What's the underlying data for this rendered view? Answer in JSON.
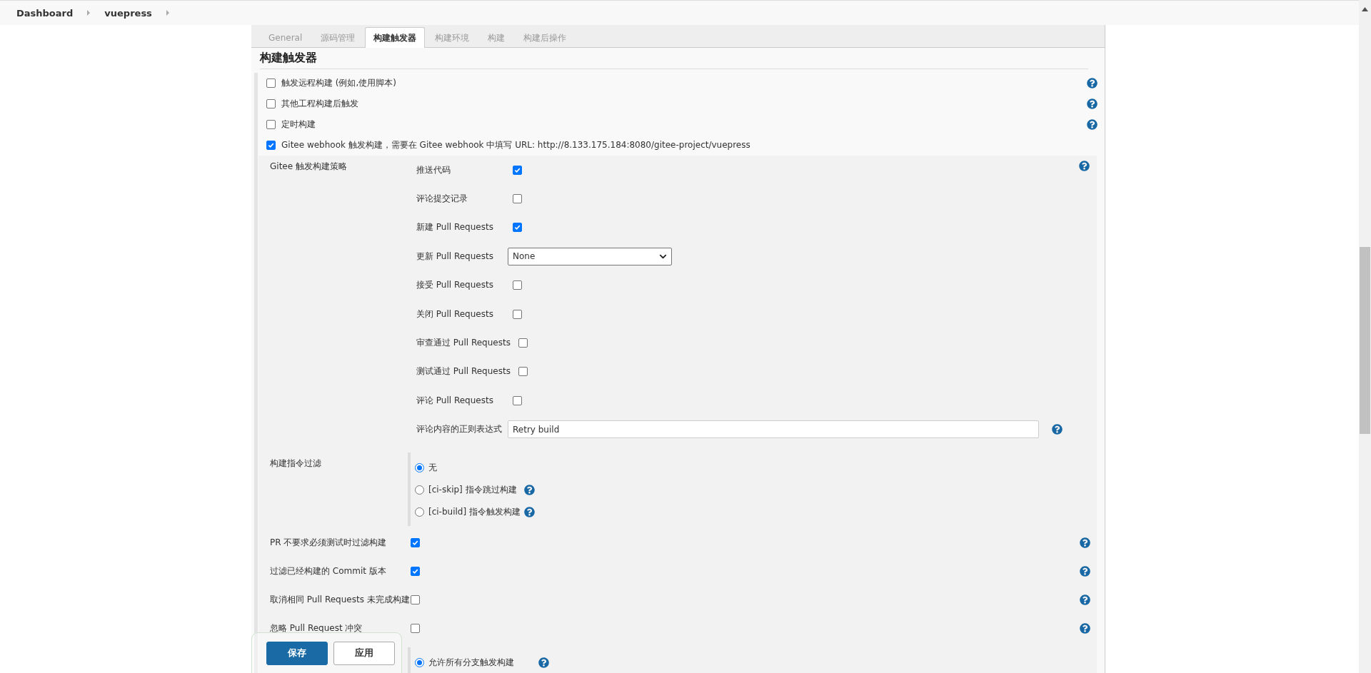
{
  "breadcrumbs": [
    "Dashboard",
    "vuepress"
  ],
  "tabs": [
    {
      "label": "General",
      "selected": false
    },
    {
      "label": "源码管理",
      "selected": false
    },
    {
      "label": "构建触发器",
      "selected": true
    },
    {
      "label": "构建环境",
      "selected": false
    },
    {
      "label": "构建",
      "selected": false
    },
    {
      "label": "构建后操作",
      "selected": false
    }
  ],
  "section_title": "构建触发器",
  "triggers": [
    {
      "label": "触发远程构建 (例如,使用脚本)",
      "checked": false,
      "help": true
    },
    {
      "label": "其他工程构建后触发",
      "checked": false,
      "help": true
    },
    {
      "label": "定时构建",
      "checked": false,
      "help": true
    },
    {
      "label": "Gitee webhook 触发构建，需要在 Gitee webhook 中填写 URL: http://8.133.175.184:8080/gitee-project/vuepress",
      "checked": true,
      "help": false
    }
  ],
  "gitee": {
    "strategy_label": "Gitee 触发构建策略",
    "strategy_items": [
      {
        "kind": "checkbox",
        "label": "推送代码",
        "checked": true
      },
      {
        "kind": "checkbox",
        "label": "评论提交记录",
        "checked": false
      },
      {
        "kind": "checkbox",
        "label": "新建 Pull Requests",
        "checked": true
      },
      {
        "kind": "select",
        "label": "更新 Pull Requests",
        "value": "None"
      },
      {
        "kind": "checkbox",
        "label": "接受 Pull Requests",
        "checked": false
      },
      {
        "kind": "checkbox",
        "label": "关闭 Pull Requests",
        "checked": false
      },
      {
        "kind": "checkbox",
        "label": "审查通过 Pull Requests",
        "checked": false
      },
      {
        "kind": "checkbox",
        "label": "测试通过 Pull Requests",
        "checked": false
      },
      {
        "kind": "checkbox",
        "label": "评论 Pull Requests",
        "checked": false
      },
      {
        "kind": "text",
        "label": "评论内容的正则表达式",
        "value": "Retry build"
      }
    ],
    "filter_label": "构建指令过滤",
    "filter_options": [
      {
        "label": "无",
        "selected": true,
        "help": false
      },
      {
        "label": "[ci-skip] 指令跳过构建",
        "selected": false,
        "help": true
      },
      {
        "label": "[ci-build] 指令触发构建",
        "selected": false,
        "help": true
      }
    ],
    "options": [
      {
        "label": "PR 不要求必须测试时过滤构建",
        "checked": true
      },
      {
        "label": "过滤已经构建的 Commit 版本",
        "checked": true
      },
      {
        "label": "取消相同 Pull Requests 未完成构建",
        "checked": false
      },
      {
        "label": "忽略 Pull Request 冲突",
        "checked": false
      }
    ],
    "branch_options": [
      {
        "label": "允许所有分支触发构建",
        "selected": true,
        "help": true
      }
    ]
  },
  "actions": [
    {
      "label": "保存",
      "kind": "primary"
    },
    {
      "label": "应用",
      "kind": "secondary"
    }
  ]
}
